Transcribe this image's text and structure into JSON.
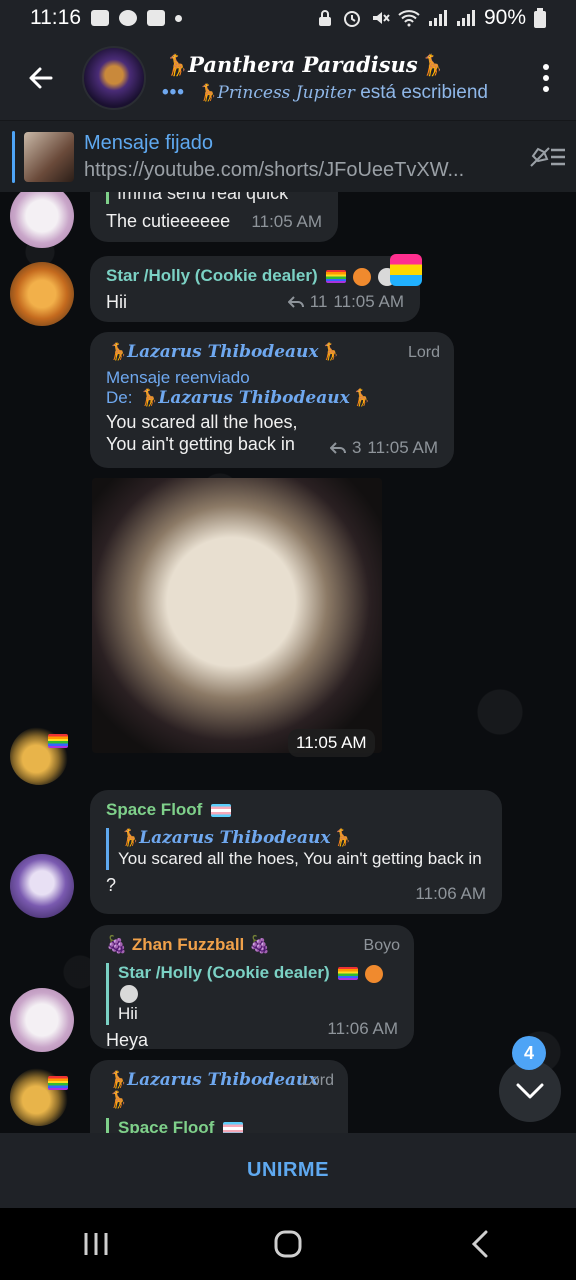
{
  "status": {
    "time": "11:16",
    "battery": "90%"
  },
  "header": {
    "title": "🦒Panthera Paradisus🦒",
    "typing_dots": "•••",
    "typing_name": "🦒Princess Jupiter",
    "typing_text": "está escribiend"
  },
  "pinned": {
    "title": "Mensaje fijado",
    "url": "https://youtube.com/shorts/JFoUeeTvXW..."
  },
  "messages": {
    "m1": {
      "line1": "Imma send real quick",
      "line2": "The cutieeeeee",
      "time": "11:05 AM"
    },
    "m2": {
      "sender": "Star /Holly (Cookie dealer)",
      "text": "Hii",
      "replies": "11",
      "time": "11:05 AM"
    },
    "m3": {
      "sender": "🦒Lazarus Thibodeaux🦒",
      "role": "Lord",
      "fwd_label": "Mensaje reenviado",
      "fwd_from_prefix": "De:",
      "fwd_from": "🦒Lazarus Thibodeaux🦒",
      "line1": "You scared all the hoes,",
      "line2": "You ain't getting back in",
      "replies": "3",
      "time": "11:05 AM"
    },
    "m4": {
      "time": "11:05 AM"
    },
    "m5": {
      "sender": "Space Floof",
      "quote_name": "🦒Lazarus Thibodeaux🦒",
      "quote_text": "You scared all the hoes, You ain't getting back in",
      "text": "?",
      "time": "11:06 AM"
    },
    "m6": {
      "sender": "🍇 Zhan Fuzzball 🍇",
      "role": "Boyo",
      "quote_name": "Star /Holly (Cookie dealer)",
      "quote_text": "Hii",
      "text": "Heya",
      "time": "11:06 AM"
    },
    "m7": {
      "sender": "🦒Lazarus Thibodeaux🦒",
      "role": "Lord",
      "quote_name": "Space Floof",
      "quote_text": "?"
    }
  },
  "scroll_badge": "4",
  "join_label": "UNIRME",
  "colors": {
    "accent": "#4ea4f6",
    "bubble": "#222529",
    "star_name": "#7bd1c4",
    "floof_name": "#7fd08a",
    "zhan_name": "#f0a14a"
  }
}
